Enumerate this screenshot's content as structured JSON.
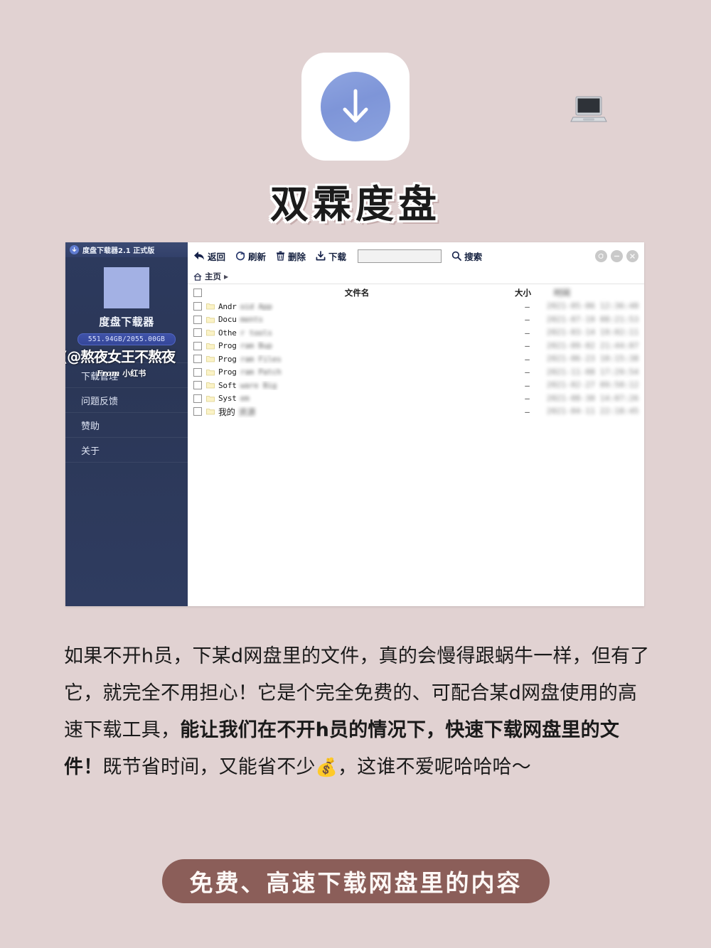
{
  "hero": {
    "app_icon_name": "download-arrow-app-icon",
    "laptop_emoji": "💻",
    "title": "双霖度盘"
  },
  "app_window": {
    "sidebar": {
      "titlebar": "度盘下载器2.1 正式版",
      "app_name": "度盘下载器",
      "quota": "551.94GB/2055.00GB",
      "menu_items": [
        {
          "label": "下载管理"
        },
        {
          "label": "问题反馈"
        },
        {
          "label": "赞助"
        },
        {
          "label": "关于"
        }
      ],
      "watermark_main": "(@熬夜女王不熬夜",
      "watermark_from": "From ",
      "watermark_source": "小红书"
    },
    "toolbar": {
      "back_label": "返回",
      "refresh_label": "刷新",
      "delete_label": "删除",
      "download_label": "下载",
      "search_value": "",
      "search_placeholder": "",
      "search_label": "搜索"
    },
    "window_controls": {
      "restore": "restore-icon",
      "minimize": "minimize-icon",
      "close": "close-icon"
    },
    "breadcrumb": {
      "home": "主页",
      "separator": "▶"
    },
    "file_table": {
      "columns": {
        "name": "文件名",
        "size": "大小",
        "date": "时间"
      },
      "rows": [
        {
          "name_clear": "Andr",
          "name_blur": "oid App",
          "size": "–",
          "date": "2021-05-06 12:36:40"
        },
        {
          "name_clear": "Docu",
          "name_blur": "ments",
          "size": "–",
          "date": "2021-07-19 08:21:53"
        },
        {
          "name_clear": "Othe",
          "name_blur": "r tools",
          "size": "–",
          "date": "2021-03-14 19:02:11"
        },
        {
          "name_clear": "Prog",
          "name_blur": "ram Bup",
          "size": "–",
          "date": "2021-09-02 21:44:07"
        },
        {
          "name_clear": "Prog",
          "name_blur": "ram Files",
          "size": "–",
          "date": "2021-06-23 10:15:38"
        },
        {
          "name_clear": "Prog",
          "name_blur": "ram Patch",
          "size": "–",
          "date": "2021-11-08 17:29:54"
        },
        {
          "name_clear": "Soft",
          "name_blur": "ware Big",
          "size": "–",
          "date": "2021-02-27 09:50:12"
        },
        {
          "name_clear": "Syst",
          "name_blur": "em",
          "size": "–",
          "date": "2021-08-30 14:07:26"
        },
        {
          "name_clear": "我的",
          "name_blur": "资源",
          "size": "–",
          "date": "2021-04-11 22:18:45"
        }
      ]
    }
  },
  "body_copy": {
    "part1": "如果不开h员，下某d网盘里的文件，真的会慢得跟蜗牛一样，但有了它，就完全不用担心！它是个完全免费的、可配合某d网盘使用的高速下载工具，",
    "bold1": "能让我们在不开h员的情况下，快速下载网盘里的文件！",
    "part2": "既节省时间，又能省不少",
    "emoji": "💰",
    "part3": "，这谁不爱呢哈哈哈～"
  },
  "bottom_pill": {
    "text": "免费、高速下载网盘里的内容",
    "color": "#8b5e59"
  }
}
